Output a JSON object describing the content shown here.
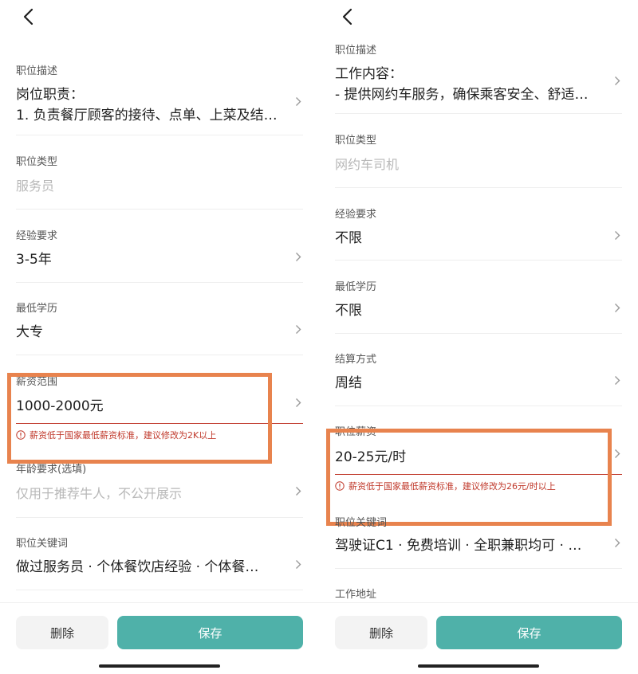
{
  "left": {
    "fields": {
      "description": {
        "label": "职位描述",
        "line1": "岗位职责：",
        "line2": "1. 负责餐厅顾客的接待、点单、上菜及结…"
      },
      "type": {
        "label": "职位类型",
        "value": "服务员"
      },
      "experience": {
        "label": "经验要求",
        "value": "3-5年"
      },
      "education": {
        "label": "最低学历",
        "value": "大专"
      },
      "salary": {
        "label": "薪资范围",
        "value": "1000-2000元",
        "error": "薪资低于国家最低薪资标准，建议修改为2K以上"
      },
      "age": {
        "label": "年龄要求(选填)",
        "placeholder": "仅用于推荐牛人，不公开展示"
      },
      "keywords": {
        "label": "职位关键词",
        "value": "做过服务员 · 个体餐饮店经验 · 个体餐…"
      }
    },
    "buttons": {
      "delete": "删除",
      "save": "保存"
    }
  },
  "right": {
    "fields": {
      "description": {
        "label": "职位描述",
        "line1": "工作内容：",
        "line2": "- 提供网约车服务，确保乘客安全、舒适…"
      },
      "type": {
        "label": "职位类型",
        "value": "网约车司机"
      },
      "experience": {
        "label": "经验要求",
        "value": "不限"
      },
      "education": {
        "label": "最低学历",
        "value": "不限"
      },
      "settlement": {
        "label": "结算方式",
        "value": "周结"
      },
      "salary": {
        "label": "职位薪资",
        "value": "20-25元/时",
        "error": "薪资低于国家最低薪资标准，建议修改为26元/时以上"
      },
      "keywords": {
        "label": "职位关键词",
        "value": "驾驶证C1 · 免费培训 · 全职兼职均可 · …"
      },
      "address": {
        "label": "工作地址"
      }
    },
    "buttons": {
      "delete": "删除",
      "save": "保存"
    }
  },
  "colors": {
    "accent": "#4fb1a9",
    "error": "#c0392b",
    "highlight": "#e8834e"
  }
}
